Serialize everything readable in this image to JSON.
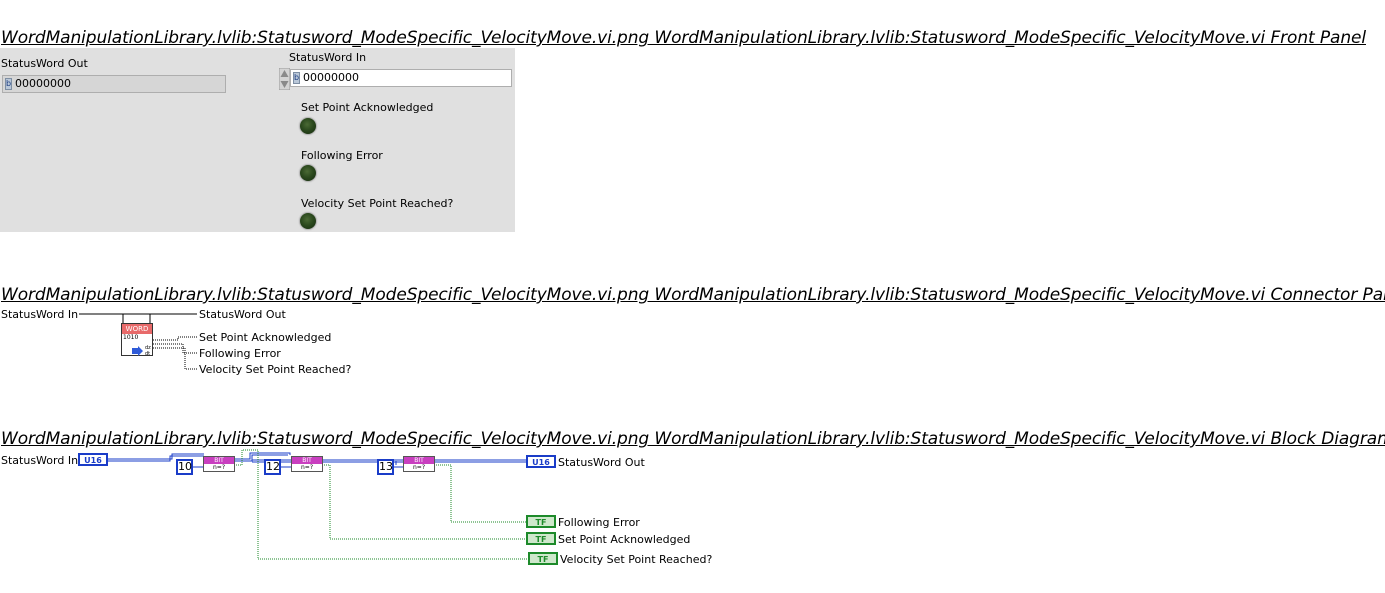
{
  "titles": {
    "front_panel": "WordManipulationLibrary.lvlib:Statusword_ModeSpecific_VelocityMove.vi.png  WordManipulationLibrary.lvlib:Statusword_ModeSpecific_VelocityMove.vi Front Panel",
    "connector_pane": "WordManipulationLibrary.lvlib:Statusword_ModeSpecific_VelocityMove.vi.png  WordManipulationLibrary.lvlib:Statusword_ModeSpecific_VelocityMove.vi Connector Pane",
    "block_diagram": "WordManipulationLibrary.lvlib:Statusword_ModeSpecific_VelocityMove.vi.png  WordManipulationLibrary.lvlib:Statusword_ModeSpecific_VelocityMove.vi Block Diagram"
  },
  "front_panel": {
    "statusword_out": {
      "label": "StatusWord Out",
      "value": "00000000",
      "radix": "b"
    },
    "statusword_in": {
      "label": "StatusWord In",
      "value": "00000000",
      "radix": "b"
    },
    "leds": [
      {
        "label": "Set Point Acknowledged"
      },
      {
        "label": "Following Error"
      },
      {
        "label": "Velocity Set Point Reached?"
      }
    ]
  },
  "connector_pane": {
    "input": "StatusWord In",
    "output": "StatusWord Out",
    "icon_header": "WORD",
    "icon_body": "1010",
    "outputs": [
      "Set Point Acknowledged",
      "Following Error",
      "Velocity Set Point Reached?"
    ]
  },
  "block_diagram": {
    "input_label": "StatusWord In",
    "output_label": "StatusWord Out",
    "u16": "U16",
    "tf": "TF",
    "bit_header": "BIT",
    "bit_body": "n=?",
    "constants": [
      "10",
      "12",
      "13"
    ],
    "indicators": [
      "Following Error",
      "Set Point Acknowledged",
      "Velocity Set Point Reached?"
    ]
  },
  "colors": {
    "u16_wire": "#1a3cc8",
    "bool_wire": "#1d8a2a",
    "panel_bg": "#e0e0e0",
    "bit_fn": "#c93fc0",
    "word_icon": "#e86a6a"
  }
}
